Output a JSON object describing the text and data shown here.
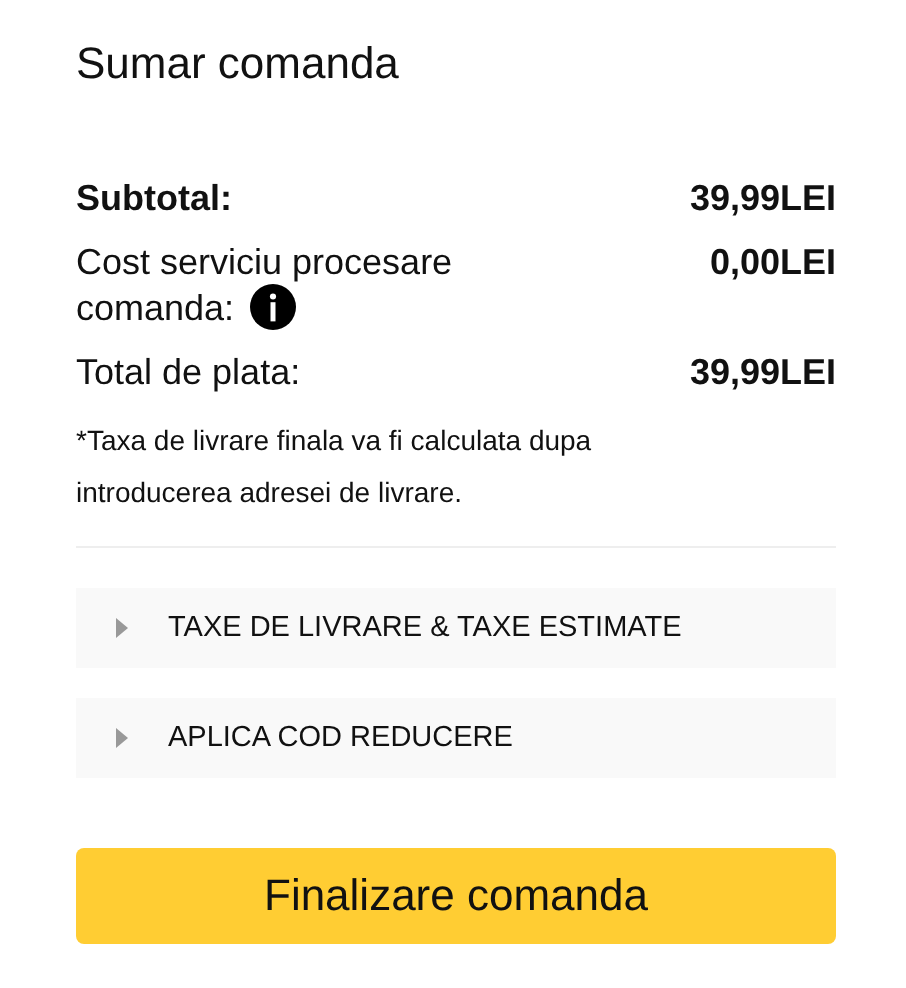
{
  "title": "Sumar comanda",
  "rows": [
    {
      "label": "Subtotal:",
      "value": "39,99LEI",
      "bold": true,
      "info": false
    },
    {
      "label": "Cost serviciu procesare comanda:",
      "value": "0,00LEI",
      "bold": false,
      "info": true
    },
    {
      "label": "Total de plata:",
      "value": "39,99LEI",
      "bold": false,
      "info": false
    }
  ],
  "note": "*Taxa de livrare finala va fi calculata dupa introducerea adresei de livrare.",
  "sections": [
    {
      "label": "TAXE DE LIVRARE & TAXE ESTIMATE",
      "expanded": false
    },
    {
      "label": "APLICA COD REDUCERE",
      "expanded": false
    }
  ],
  "button": "Finalizare comanda"
}
